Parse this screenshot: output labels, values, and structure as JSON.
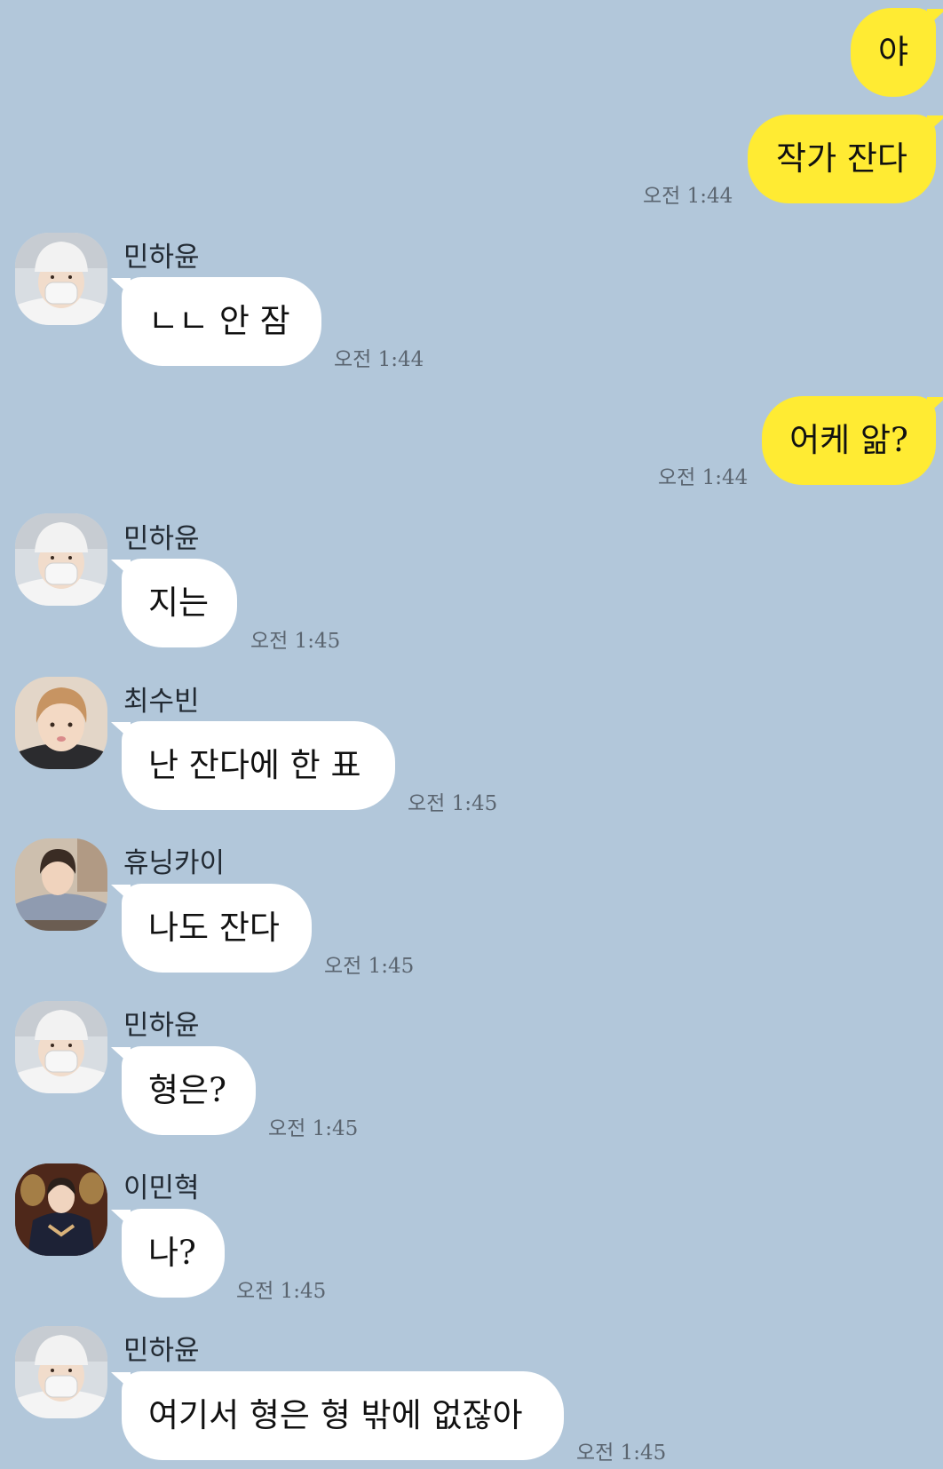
{
  "chat": {
    "messages": [
      {
        "text": "야",
        "time": ""
      },
      {
        "text": "작가 잔다",
        "time": "오전 1:44"
      },
      {
        "sender": "민하윤",
        "text": "ㄴㄴ 안 잠",
        "time": "오전 1:44"
      },
      {
        "text": "어케 앎?",
        "time": "오전 1:44"
      },
      {
        "sender": "민하윤",
        "text": "지는",
        "time": "오전 1:45"
      },
      {
        "sender": "최수빈",
        "text": "난 잔다에 한 표",
        "time": "오전 1:45"
      },
      {
        "sender": "휴닝카이",
        "text": "나도 잔다",
        "time": "오전 1:45"
      },
      {
        "sender": "민하윤",
        "text": "형은?",
        "time": "오전 1:45"
      },
      {
        "sender": "이민혁",
        "text": "나?",
        "time": "오전 1:45"
      },
      {
        "sender": "민하윤",
        "text": "여기서 형은 형 밖에 없잖아",
        "time": "오전 1:45"
      }
    ]
  },
  "colors": {
    "background": "#b2c7da",
    "my_bubble": "#ffeb33",
    "their_bubble": "#ffffff",
    "timestamp": "#5b6570"
  }
}
